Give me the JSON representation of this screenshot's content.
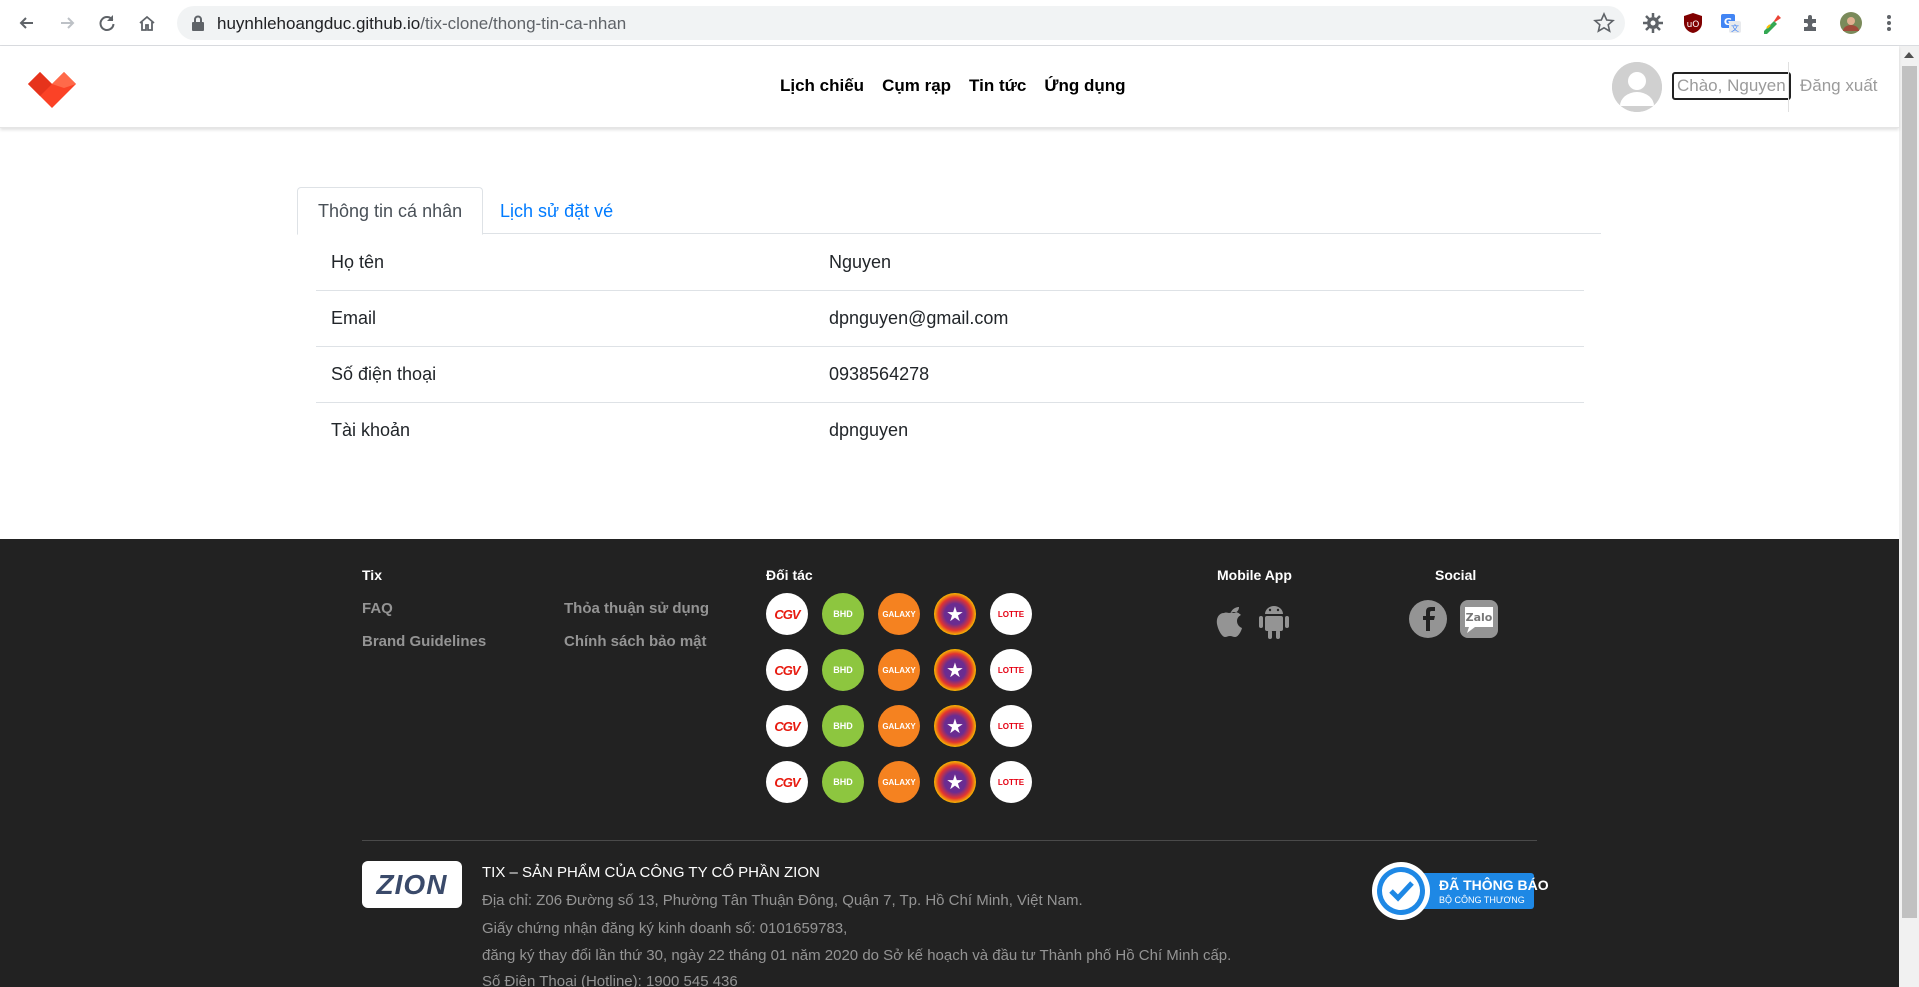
{
  "browser": {
    "url_host": "huynhlehoangduc.github.io",
    "url_path": "/tix-clone/thong-tin-ca-nhan"
  },
  "header": {
    "nav": [
      "Lịch chiếu",
      "Cụm rạp",
      "Tin tức",
      "Ứng dụng"
    ],
    "greeting": "Chào, Nguyen",
    "logout": "Đăng xuất"
  },
  "tabs": {
    "active": "Thông tin cá nhân",
    "other": "Lịch sử đặt vé"
  },
  "profile": [
    {
      "label": "Họ tên",
      "value": "Nguyen"
    },
    {
      "label": "Email",
      "value": "dpnguyen@gmail.com"
    },
    {
      "label": "Số điện thoại",
      "value": "0938564278"
    },
    {
      "label": "Tài khoản",
      "value": "dpnguyen"
    }
  ],
  "footer": {
    "tix_heading": "Tix",
    "links_col1": [
      "FAQ",
      "Brand Guidelines"
    ],
    "links_col2": [
      "Thỏa thuận sử dụng",
      "Chính sách bảo mật"
    ],
    "partners_heading": "Đối tác",
    "partner_icons": [
      "cgv-logo-icon",
      "bhd-star-logo-icon",
      "galaxy-cinema-logo-icon",
      "cinestar-logo-icon",
      "lotte-cinema-logo-icon"
    ],
    "mobile_heading": "Mobile App",
    "social_heading": "Social",
    "zion_logo": "ZION",
    "company_title": "TIX – SẢN PHẨM CỦA CÔNG TY CỔ PHẦN ZION",
    "address": "Địa chỉ: Z06 Đường số 13, Phường Tân Thuận Đông, Quận 7, Tp. Hồ Chí Minh, Việt Nam.",
    "license": "Giấy chứng nhận đăng ký kinh doanh số: 0101659783,",
    "license_change": "đăng ký thay đổi lần thứ 30, ngày 22 tháng 01 năm 2020 do Sở kế hoạch và đầu tư Thành phố Hồ Chí Minh cấp.",
    "hotline": "Số Điện Thoại (Hotline): 1900 545 436",
    "badge_line1": "ĐÃ THÔNG BÁO",
    "badge_line2": "BỘ CÔNG THƯƠNG"
  },
  "colors": {
    "link_blue": "#007bff",
    "footer_bg": "#222222",
    "brand_red": "#fb4226"
  }
}
